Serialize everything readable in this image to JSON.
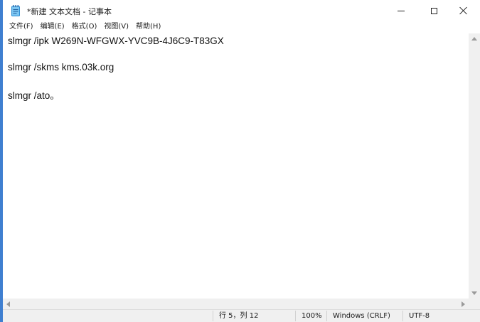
{
  "window": {
    "title": "*新建 文本文档 - 记事本",
    "app_icon": "notepad-icon"
  },
  "menu": {
    "items": [
      {
        "label": "文件(F)"
      },
      {
        "label": "编辑(E)"
      },
      {
        "label": "格式(O)"
      },
      {
        "label": "视图(V)"
      },
      {
        "label": "帮助(H)"
      }
    ]
  },
  "editor": {
    "lines": [
      "slmgr /ipk W269N-WFGWX-YVC9B-4J6C9-T83GX",
      "slmgr /skms kms.03k.org",
      "slmgr /ato。"
    ]
  },
  "status": {
    "position": "行 5，列 12",
    "zoom": "100%",
    "line_ending": "Windows (CRLF)",
    "encoding": "UTF-8"
  },
  "colors": {
    "desktop": "#3f7fd0",
    "window_bg": "#ffffff",
    "chrome_bg": "#f0f0f0"
  }
}
